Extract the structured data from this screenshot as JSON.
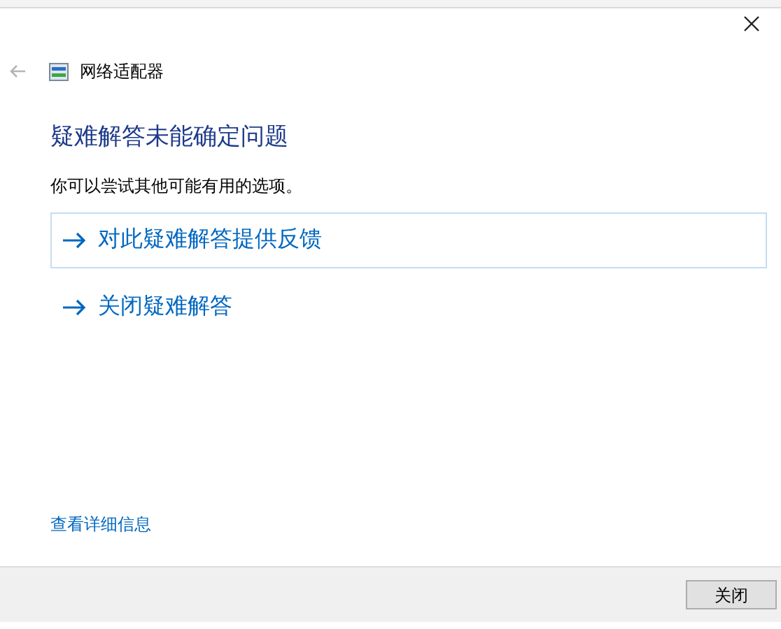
{
  "window": {
    "title": "网络适配器"
  },
  "heading": "疑难解答未能确定问题",
  "description": "你可以尝试其他可能有用的选项。",
  "options": [
    {
      "label": "对此疑难解答提供反馈",
      "selected": true
    },
    {
      "label": "关闭疑难解答",
      "selected": false
    }
  ],
  "details_link": "查看详细信息",
  "buttons": [
    "关闭"
  ]
}
